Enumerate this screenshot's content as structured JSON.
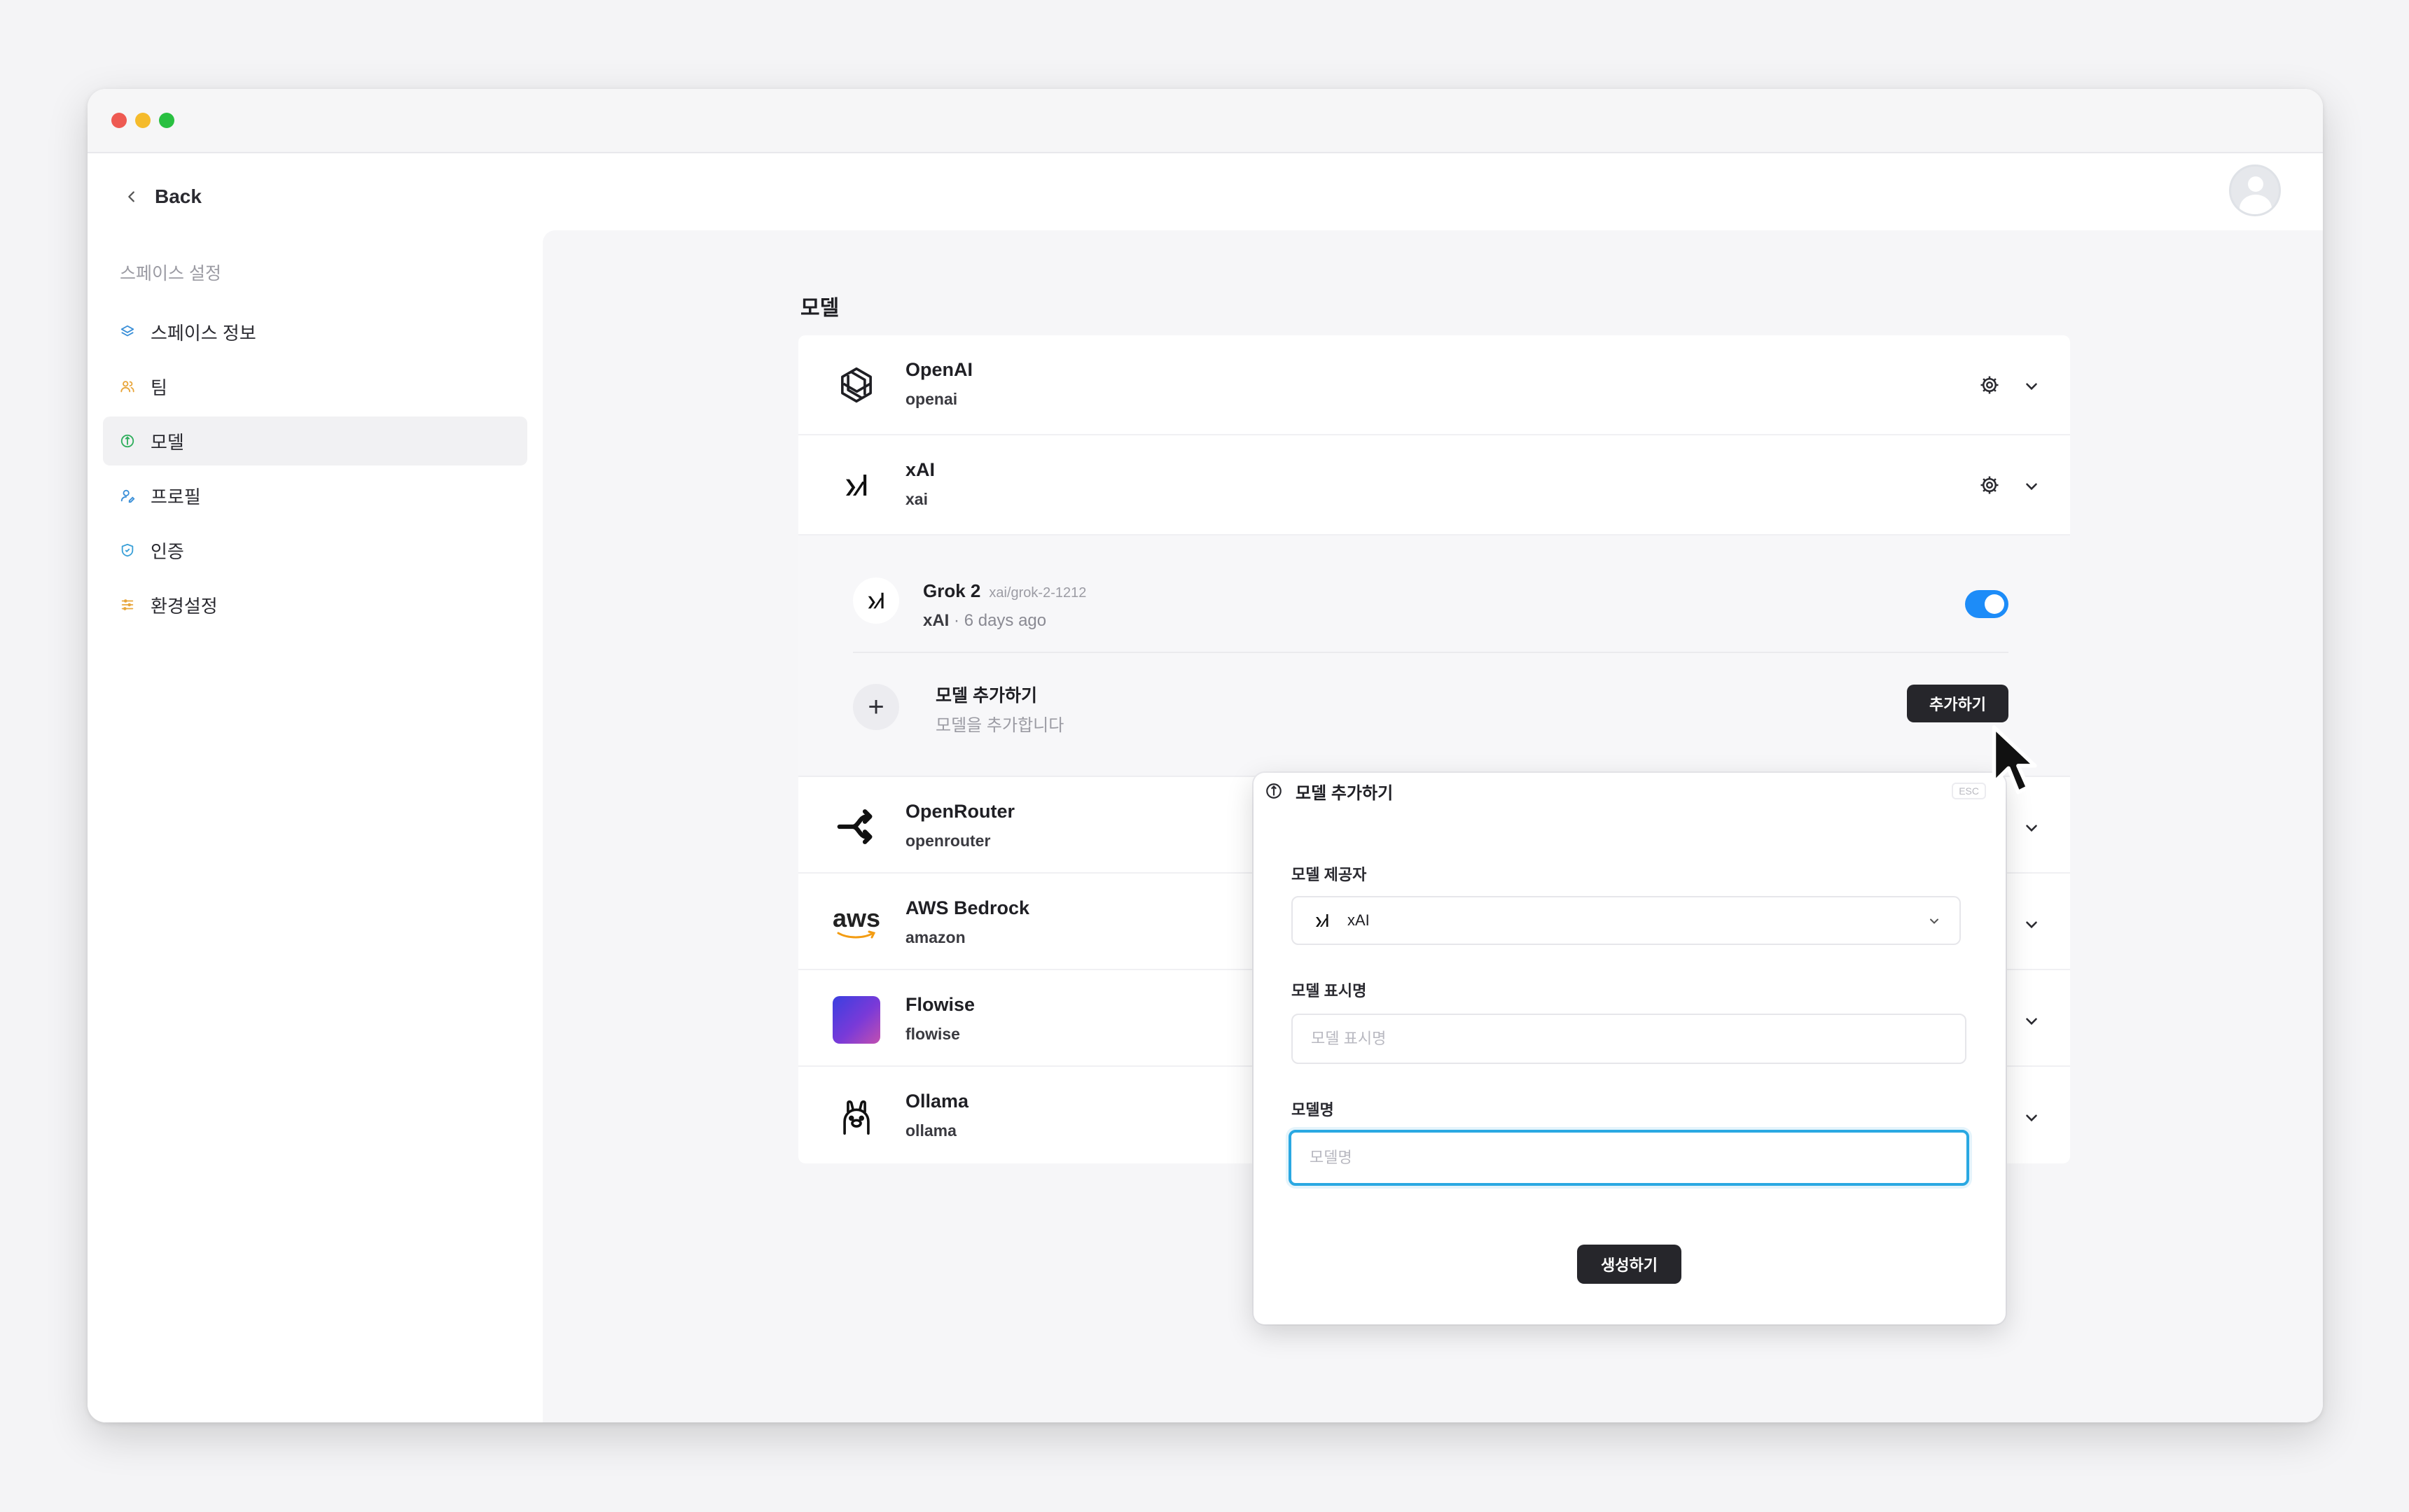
{
  "sidebar": {
    "back_label": "Back",
    "section_title": "스페이스 설정",
    "items": [
      {
        "label": "스페이스 정보",
        "icon": "layers-icon",
        "color": "#3a8fd8"
      },
      {
        "label": "팀",
        "icon": "users-icon",
        "color": "#e8a53a"
      },
      {
        "label": "모델",
        "icon": "model-icon",
        "color": "#2fae5c"
      },
      {
        "label": "프로필",
        "icon": "user-edit-icon",
        "color": "#3a8fd8"
      },
      {
        "label": "인증",
        "icon": "shield-icon",
        "color": "#3aa0d8"
      },
      {
        "label": "환경설정",
        "icon": "sliders-icon",
        "color": "#e8a53a"
      }
    ]
  },
  "content": {
    "title": "모델",
    "providers": [
      {
        "name": "OpenAI",
        "id": "openai",
        "icon": "openai-icon"
      },
      {
        "name": "xAI",
        "id": "xai",
        "icon": "xai-icon"
      },
      {
        "name": "OpenRouter",
        "id": "openrouter",
        "icon": "openrouter-icon"
      },
      {
        "name": "AWS Bedrock",
        "id": "amazon",
        "icon": "aws-icon"
      },
      {
        "name": "Flowise",
        "id": "flowise",
        "icon": "flowise-icon"
      },
      {
        "name": "Ollama",
        "id": "ollama",
        "icon": "ollama-icon"
      }
    ],
    "xai_models": [
      {
        "name": "Grok 2",
        "model_id": "xai/grok-2-1212",
        "provider": "xAI",
        "updated": "6 days ago",
        "enabled": true
      }
    ],
    "add_model": {
      "title": "모델 추가하기",
      "description": "모델을 추가합니다",
      "button": "추가하기"
    },
    "aws_logo_text": "aws"
  },
  "dialog": {
    "title": "모델 추가하기",
    "esc": "ESC",
    "provider_label": "모델 제공자",
    "provider_value": "xAI",
    "display_name_label": "모델 표시명",
    "display_name_placeholder": "모델 표시명",
    "model_name_label": "모델명",
    "model_name_placeholder": "모델명",
    "create_button": "생성하기"
  },
  "colors": {
    "accent_toggle": "#1d8cf8",
    "focus_ring": "#2aa8e2",
    "dark_button": "#26262b"
  }
}
